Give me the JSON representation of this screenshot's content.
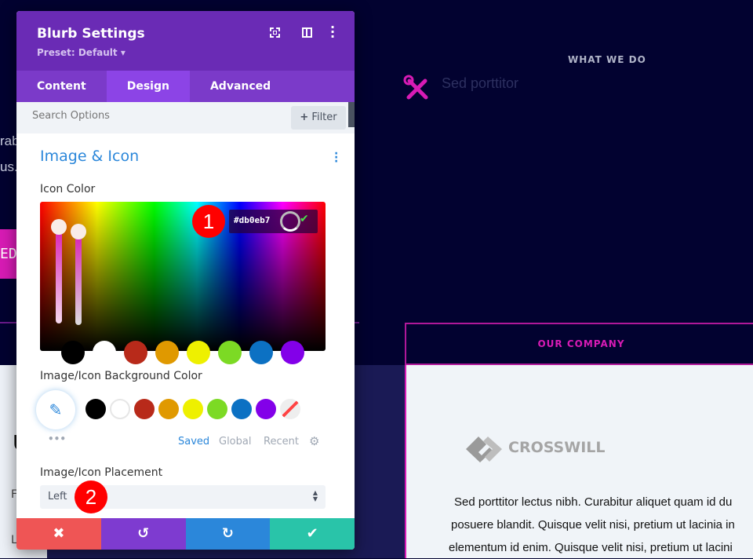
{
  "background": {
    "what_we_do": "WHAT WE DO",
    "blurb_title": "Sed porttitor",
    "left_fragment_1": "rab",
    "left_fragment_2": "us.",
    "left_button": "EDU",
    "left_frag_u": "U",
    "left_frag_f": "F",
    "left_frag_l": "L",
    "our_company": "OUR COMPANY",
    "logo_text": "CROSSWILL",
    "body_lines": [
      "Sed porttitor lectus nibh. Curabitur aliquet quam id du",
      "posuere blandit. Quisque velit nisi, pretium ut lacinia in",
      "elementum id enim. Quisque velit nisi, pretium ut lacini"
    ],
    "accent": "#d81bb5"
  },
  "modal": {
    "title": "Blurb Settings",
    "preset": "Preset: Default",
    "tabs": [
      {
        "label": "Content"
      },
      {
        "label": "Design",
        "active": true
      },
      {
        "label": "Advanced"
      }
    ],
    "search_placeholder": "Search Options",
    "filter_label": "Filter",
    "section_title": "Image & Icon",
    "icon_color_label": "Icon Color",
    "icon_color_value": "#db0eb7",
    "palette": [
      "#000000",
      "#ffffff",
      "#b82a1a",
      "#e09900",
      "#eef000",
      "#7cda24",
      "#0c71c3",
      "#8300e9"
    ],
    "bg_color_label": "Image/Icon Background Color",
    "palette_tabs": {
      "saved": "Saved",
      "global": "Global",
      "recent": "Recent"
    },
    "placement_label": "Image/Icon Placement",
    "placement_value": "Left",
    "footer_colors": {
      "cancel": "#ef5555",
      "undo": "#7e3bd0",
      "redo": "#2b87da",
      "save": "#29c4a9"
    }
  },
  "annotations": [
    "1",
    "2"
  ]
}
